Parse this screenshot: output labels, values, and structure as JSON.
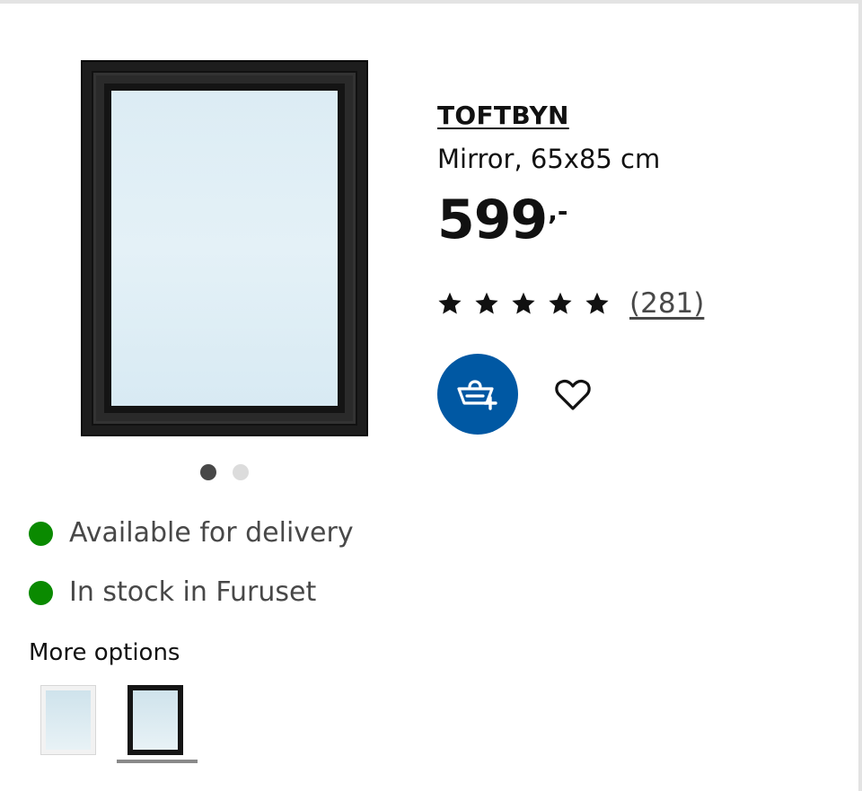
{
  "product": {
    "name": "TOFTBYN",
    "description": "Mirror, 65x85 cm",
    "price_integer": "599",
    "price_suffix": ",-",
    "rating": {
      "stars": 5,
      "review_count_label": "(281)"
    }
  },
  "carousel": {
    "total": 2,
    "active_index": 0
  },
  "actions": {
    "add_to_cart_icon": "add-to-cart-icon",
    "favourite_icon": "heart-icon"
  },
  "availability": [
    {
      "text": "Available for delivery",
      "status_color": "#0a8a00"
    },
    {
      "text": "In stock in Furuset",
      "status_color": "#0a8a00"
    }
  ],
  "more_options": {
    "title": "More options",
    "options": [
      {
        "variant": "white-frame",
        "selected": false
      },
      {
        "variant": "black-frame",
        "selected": true
      }
    ]
  },
  "colors": {
    "accent_blue": "#0058a3",
    "in_stock_green": "#0a8a00"
  }
}
